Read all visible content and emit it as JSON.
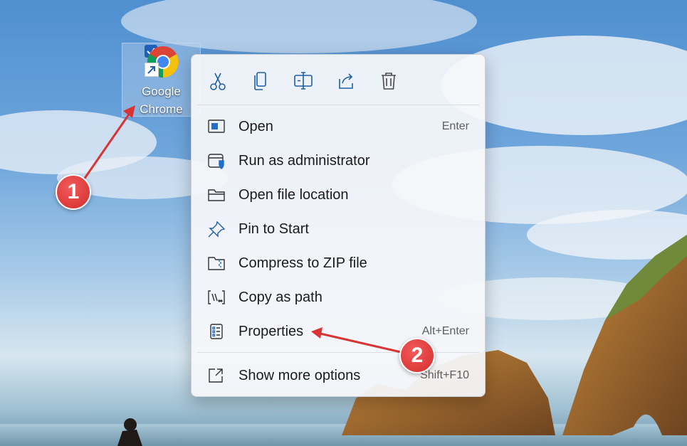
{
  "desktop": {
    "shortcut_label_line1": "Google",
    "shortcut_label_line2": "Chrome"
  },
  "context_menu": {
    "toolbar": [
      {
        "name": "cut-icon"
      },
      {
        "name": "copy-icon"
      },
      {
        "name": "rename-icon"
      },
      {
        "name": "share-icon"
      },
      {
        "name": "delete-icon"
      }
    ],
    "items": [
      {
        "label": "Open",
        "shortcut": "Enter",
        "icon": "open-icon"
      },
      {
        "label": "Run as administrator",
        "shortcut": "",
        "icon": "run-as-admin-icon"
      },
      {
        "label": "Open file location",
        "shortcut": "",
        "icon": "folder-icon"
      },
      {
        "label": "Pin to Start",
        "shortcut": "",
        "icon": "pin-icon"
      },
      {
        "label": "Compress to ZIP file",
        "shortcut": "",
        "icon": "zip-icon"
      },
      {
        "label": "Copy as path",
        "shortcut": "",
        "icon": "copy-path-icon"
      },
      {
        "label": "Properties",
        "shortcut": "Alt+Enter",
        "icon": "properties-icon"
      },
      {
        "label": "Show more options",
        "shortcut": "Shift+F10",
        "icon": "more-options-icon"
      }
    ]
  },
  "annotations": {
    "step1": "1",
    "step2": "2",
    "accent_color": "#d93434"
  }
}
